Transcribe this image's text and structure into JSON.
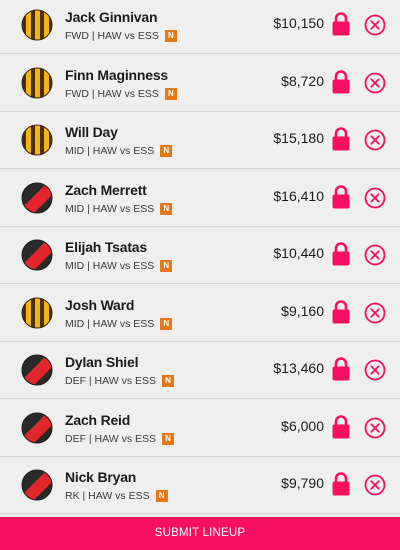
{
  "players": [
    {
      "name": "Jack Ginnivan",
      "position": "FWD",
      "match": "HAW vs ESS",
      "badge": "N",
      "price": "$10,150",
      "club": "HAW"
    },
    {
      "name": "Finn Maginness",
      "position": "FWD",
      "match": "HAW vs ESS",
      "badge": "N",
      "price": "$8,720",
      "club": "HAW"
    },
    {
      "name": "Will Day",
      "position": "MID",
      "match": "HAW vs ESS",
      "badge": "N",
      "price": "$15,180",
      "club": "HAW"
    },
    {
      "name": "Zach Merrett",
      "position": "MID",
      "match": "HAW vs ESS",
      "badge": "N",
      "price": "$16,410",
      "club": "ESS"
    },
    {
      "name": "Elijah Tsatas",
      "position": "MID",
      "match": "HAW vs ESS",
      "badge": "N",
      "price": "$10,440",
      "club": "ESS"
    },
    {
      "name": "Josh Ward",
      "position": "MID",
      "match": "HAW vs ESS",
      "badge": "N",
      "price": "$9,160",
      "club": "HAW"
    },
    {
      "name": "Dylan Shiel",
      "position": "DEF",
      "match": "HAW vs ESS",
      "badge": "N",
      "price": "$13,460",
      "club": "ESS"
    },
    {
      "name": "Zach Reid",
      "position": "DEF",
      "match": "HAW vs ESS",
      "badge": "N",
      "price": "$6,000",
      "club": "ESS"
    },
    {
      "name": "Nick Bryan",
      "position": "RK",
      "match": "HAW vs ESS",
      "badge": "N",
      "price": "$9,790",
      "club": "ESS"
    }
  ],
  "submit_label": "SUBMIT LINEUP",
  "colors": {
    "accent": "#f5115f",
    "badge": "#e57818",
    "haw_brown": "#4a2e14",
    "haw_gold": "#f2b519",
    "ess_black": "#2a2a2a",
    "ess_red": "#e3262c"
  },
  "icons": {
    "haw": "hawthorn-jersey-icon",
    "ess": "essendon-jersey-icon",
    "lock": "lock-icon",
    "remove": "remove-circle-icon"
  }
}
